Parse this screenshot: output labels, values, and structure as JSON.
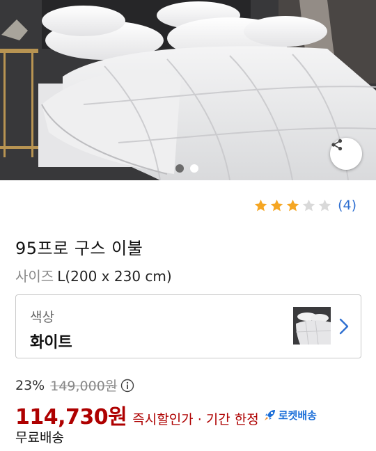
{
  "product": {
    "rating": {
      "stars": 3,
      "max_stars": 5,
      "count_text": "(4)"
    },
    "title": "95프로 구스 이불",
    "size": {
      "label": "사이즈",
      "value": "L(200 x 230 cm)"
    },
    "option": {
      "label": "색상",
      "value": "화이트"
    },
    "price": {
      "discount": "23%",
      "original": "149,000원",
      "sale": "114,730원",
      "note": "즉시할인가 · 기간 한정",
      "delivery_badge": "로켓배송"
    },
    "shipping": "무료배송"
  },
  "gallery": {
    "total_images": 2,
    "current_index": 1
  },
  "colors": {
    "price_red": "#ae0000",
    "link_blue": "#2e6fd1",
    "star_filled": "#f5a623",
    "star_empty": "#d9d9d9",
    "rocket_blue": "#1a6ed8"
  },
  "icons": {
    "share": "share-icon",
    "chevron": "chevron-right-icon",
    "info": "info-icon",
    "rocket": "rocket-icon",
    "star": "star-icon"
  }
}
